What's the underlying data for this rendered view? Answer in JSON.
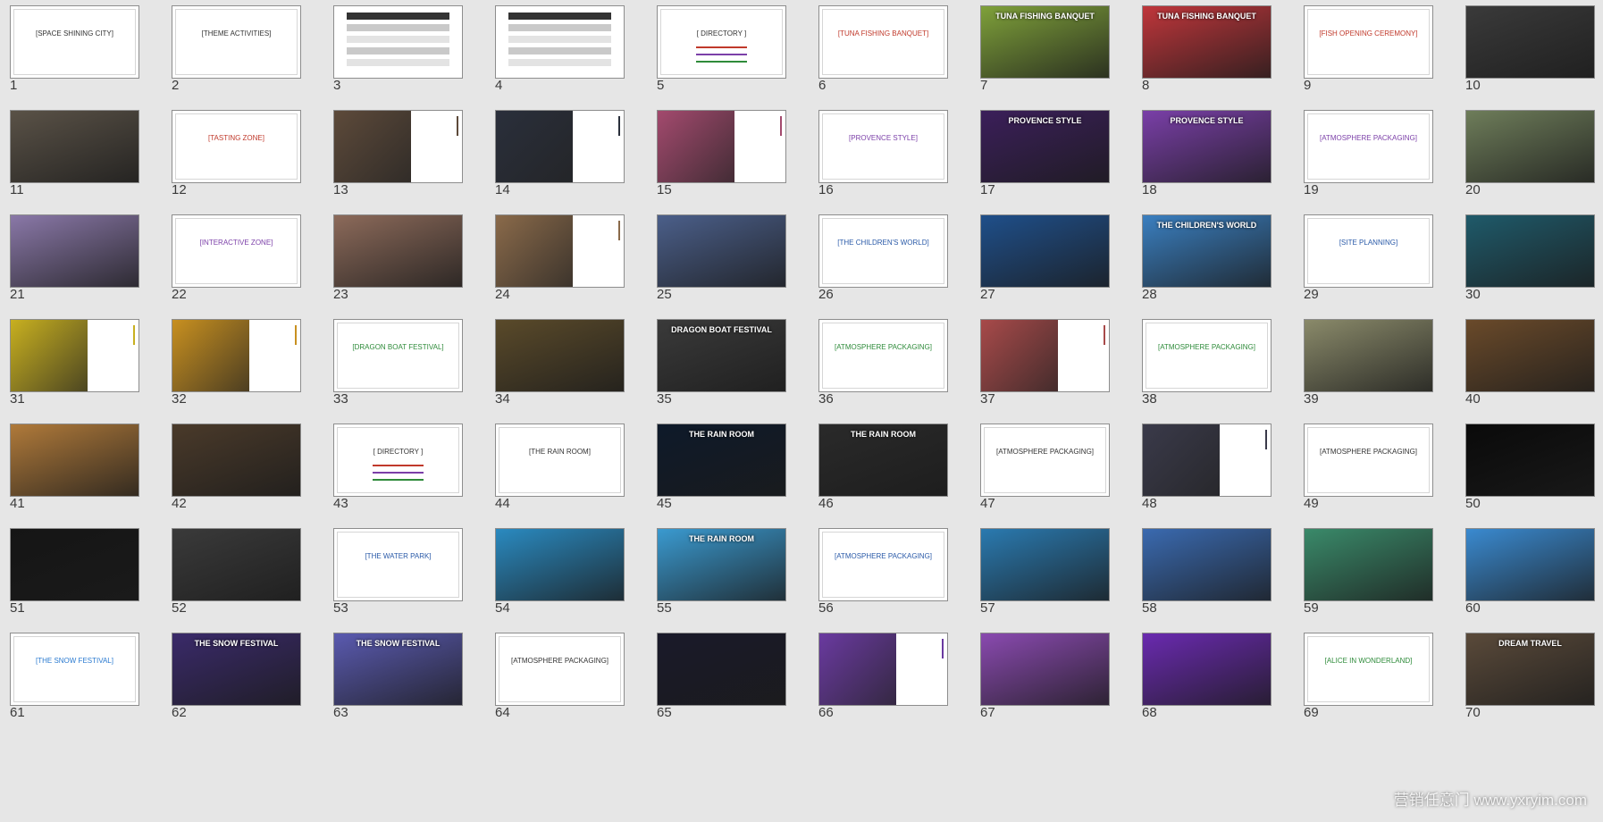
{
  "slides": [
    {
      "n": "1",
      "kind": "title",
      "title": "[SPACE SHINING CITY]",
      "sub": "",
      "accent": "#333333"
    },
    {
      "n": "2",
      "kind": "title",
      "title": "[THEME ACTIVITIES]",
      "sub": "",
      "accent": "#333333"
    },
    {
      "n": "3",
      "kind": "table",
      "title": "",
      "sub": "",
      "accent": "#555555"
    },
    {
      "n": "4",
      "kind": "table",
      "title": "",
      "sub": "",
      "accent": "#555555"
    },
    {
      "n": "5",
      "kind": "directory",
      "title": "[ DIRECTORY ]",
      "sub": "",
      "accent": "#333333"
    },
    {
      "n": "6",
      "kind": "title",
      "title": "[TUNA FISHING BANQUET]",
      "sub": "",
      "accent": "#c0392b"
    },
    {
      "n": "7",
      "kind": "photo",
      "title": "TUNA FISHING BANQUET",
      "sub": "",
      "accent": "#7fa13a"
    },
    {
      "n": "8",
      "kind": "photo",
      "title": "TUNA FISHING BANQUET",
      "sub": "",
      "accent": "#c0363b"
    },
    {
      "n": "9",
      "kind": "title",
      "title": "[FISH OPENING CEREMONY]",
      "sub": "",
      "accent": "#c0392b"
    },
    {
      "n": "10",
      "kind": "photo",
      "title": "",
      "sub": "",
      "accent": "#3a3a3a"
    },
    {
      "n": "11",
      "kind": "photo",
      "title": "",
      "sub": "",
      "accent": "#5a5247"
    },
    {
      "n": "12",
      "kind": "title",
      "title": "[TASTING ZONE]",
      "sub": "",
      "accent": "#c0392b"
    },
    {
      "n": "13",
      "kind": "side",
      "title": "",
      "sub": "",
      "accent": "#5d4a3a"
    },
    {
      "n": "14",
      "kind": "side",
      "title": "",
      "sub": "",
      "accent": "#2a2f3b"
    },
    {
      "n": "15",
      "kind": "side",
      "title": "",
      "sub": "",
      "accent": "#a34a6e"
    },
    {
      "n": "16",
      "kind": "title",
      "title": "[PROVENCE STYLE]",
      "sub": "",
      "accent": "#7b3fa8"
    },
    {
      "n": "17",
      "kind": "photo",
      "title": "PROVENCE STYLE",
      "sub": "",
      "accent": "#3b1f5a"
    },
    {
      "n": "18",
      "kind": "photo",
      "title": "PROVENCE STYLE",
      "sub": "",
      "accent": "#7a3fa8"
    },
    {
      "n": "19",
      "kind": "title",
      "title": "[ATMOSPHERE PACKAGING]",
      "sub": "",
      "accent": "#7b3fa8"
    },
    {
      "n": "20",
      "kind": "photo",
      "title": "",
      "sub": "",
      "accent": "#6e7d5a"
    },
    {
      "n": "21",
      "kind": "photo",
      "title": "",
      "sub": "",
      "accent": "#8a78a8"
    },
    {
      "n": "22",
      "kind": "title",
      "title": "[INTERACTIVE ZONE]",
      "sub": "",
      "accent": "#7b3fa8"
    },
    {
      "n": "23",
      "kind": "photo",
      "title": "",
      "sub": "",
      "accent": "#8c6a5a"
    },
    {
      "n": "24",
      "kind": "side",
      "title": "",
      "sub": "",
      "accent": "#8a6a4a"
    },
    {
      "n": "25",
      "kind": "photo",
      "title": "",
      "sub": "",
      "accent": "#4b5f8a"
    },
    {
      "n": "26",
      "kind": "title",
      "title": "[THE CHILDREN'S WORLD]",
      "sub": "",
      "accent": "#2a5aa8"
    },
    {
      "n": "27",
      "kind": "photo",
      "title": "",
      "sub": "",
      "accent": "#1f4f8a"
    },
    {
      "n": "28",
      "kind": "photo",
      "title": "THE CHILDREN'S WORLD",
      "sub": "",
      "accent": "#3a7fc0"
    },
    {
      "n": "29",
      "kind": "title",
      "title": "[SITE PLANNING]",
      "sub": "",
      "accent": "#2a5aa8"
    },
    {
      "n": "30",
      "kind": "photo",
      "title": "",
      "sub": "",
      "accent": "#1f5a6a"
    },
    {
      "n": "31",
      "kind": "side",
      "title": "",
      "sub": "",
      "accent": "#c8b020"
    },
    {
      "n": "32",
      "kind": "side",
      "title": "",
      "sub": "",
      "accent": "#c89020"
    },
    {
      "n": "33",
      "kind": "title",
      "title": "[DRAGON BOAT FESTIVAL]",
      "sub": "",
      "accent": "#2e8b3a"
    },
    {
      "n": "34",
      "kind": "photo",
      "title": "",
      "sub": "",
      "accent": "#5a4a2a"
    },
    {
      "n": "35",
      "kind": "photo",
      "title": "DRAGON BOAT FESTIVAL",
      "sub": "",
      "accent": "#3a3a3a"
    },
    {
      "n": "36",
      "kind": "title",
      "title": "[ATMOSPHERE PACKAGING]",
      "sub": "",
      "accent": "#2e8b3a"
    },
    {
      "n": "37",
      "kind": "side",
      "title": "",
      "sub": "",
      "accent": "#a84a4a"
    },
    {
      "n": "38",
      "kind": "title",
      "title": "[ATMOSPHERE PACKAGING]",
      "sub": "",
      "accent": "#2e8b3a"
    },
    {
      "n": "39",
      "kind": "photo",
      "title": "",
      "sub": "",
      "accent": "#8a8a6a"
    },
    {
      "n": "40",
      "kind": "photo",
      "title": "",
      "sub": "",
      "accent": "#6a4a2a"
    },
    {
      "n": "41",
      "kind": "photo",
      "title": "",
      "sub": "",
      "accent": "#b07a3a"
    },
    {
      "n": "42",
      "kind": "photo",
      "title": "",
      "sub": "",
      "accent": "#4a3a2a"
    },
    {
      "n": "43",
      "kind": "directory",
      "title": "[ DIRECTORY ]",
      "sub": "",
      "accent": "#333333"
    },
    {
      "n": "44",
      "kind": "title",
      "title": "[THE RAIN ROOM]",
      "sub": "",
      "accent": "#333333"
    },
    {
      "n": "45",
      "kind": "photo",
      "title": "THE RAIN ROOM",
      "sub": "",
      "accent": "#0e1a2a"
    },
    {
      "n": "46",
      "kind": "photo",
      "title": "THE RAIN ROOM",
      "sub": "",
      "accent": "#2a2a2a"
    },
    {
      "n": "47",
      "kind": "title",
      "title": "[ATMOSPHERE PACKAGING]",
      "sub": "",
      "accent": "#333333"
    },
    {
      "n": "48",
      "kind": "side",
      "title": "",
      "sub": "",
      "accent": "#3a3a4a"
    },
    {
      "n": "49",
      "kind": "title",
      "title": "[ATMOSPHERE PACKAGING]",
      "sub": "",
      "accent": "#333333"
    },
    {
      "n": "50",
      "kind": "photo",
      "title": "",
      "sub": "",
      "accent": "#0a0a0a"
    },
    {
      "n": "51",
      "kind": "photo",
      "title": "",
      "sub": "",
      "accent": "#151515"
    },
    {
      "n": "52",
      "kind": "photo",
      "title": "",
      "sub": "",
      "accent": "#3a3a3a"
    },
    {
      "n": "53",
      "kind": "title",
      "title": "[THE WATER PARK]",
      "sub": "",
      "accent": "#2a5aa8"
    },
    {
      "n": "54",
      "kind": "photo",
      "title": "",
      "sub": "",
      "accent": "#2a8ac0"
    },
    {
      "n": "55",
      "kind": "photo",
      "title": "THE RAIN ROOM",
      "sub": "",
      "accent": "#3a9ad0"
    },
    {
      "n": "56",
      "kind": "title",
      "title": "[ATMOSPHERE PACKAGING]",
      "sub": "",
      "accent": "#2a5aa8"
    },
    {
      "n": "57",
      "kind": "photo",
      "title": "",
      "sub": "",
      "accent": "#2a7ab0"
    },
    {
      "n": "58",
      "kind": "photo",
      "title": "",
      "sub": "",
      "accent": "#3a6ab0"
    },
    {
      "n": "59",
      "kind": "photo",
      "title": "",
      "sub": "",
      "accent": "#3a8a6a"
    },
    {
      "n": "60",
      "kind": "photo",
      "title": "",
      "sub": "",
      "accent": "#3a8ad0"
    },
    {
      "n": "61",
      "kind": "title",
      "title": "[THE SNOW FESTIVAL]",
      "sub": "",
      "accent": "#2a7ad0"
    },
    {
      "n": "62",
      "kind": "photo",
      "title": "THE SNOW FESTIVAL",
      "sub": "",
      "accent": "#3a2a6a"
    },
    {
      "n": "63",
      "kind": "photo",
      "title": "THE SNOW FESTIVAL",
      "sub": "",
      "accent": "#5a5ab0"
    },
    {
      "n": "64",
      "kind": "title",
      "title": "[ATMOSPHERE PACKAGING]",
      "sub": "",
      "accent": "#333333"
    },
    {
      "n": "65",
      "kind": "photo",
      "title": "",
      "sub": "",
      "accent": "#1a1a2a"
    },
    {
      "n": "66",
      "kind": "side",
      "title": "",
      "sub": "",
      "accent": "#6a3aa0"
    },
    {
      "n": "67",
      "kind": "photo",
      "title": "",
      "sub": "",
      "accent": "#8a4ab0"
    },
    {
      "n": "68",
      "kind": "photo",
      "title": "",
      "sub": "",
      "accent": "#6a2ab0"
    },
    {
      "n": "69",
      "kind": "title",
      "title": "[ALICE IN WONDERLAND]",
      "sub": "",
      "accent": "#2e8b3a"
    },
    {
      "n": "70",
      "kind": "photo",
      "title": "DREAM TRAVEL",
      "sub": "",
      "accent": "#5a4a3a"
    }
  ],
  "watermark": "营销任意门 www.yxryim.com"
}
